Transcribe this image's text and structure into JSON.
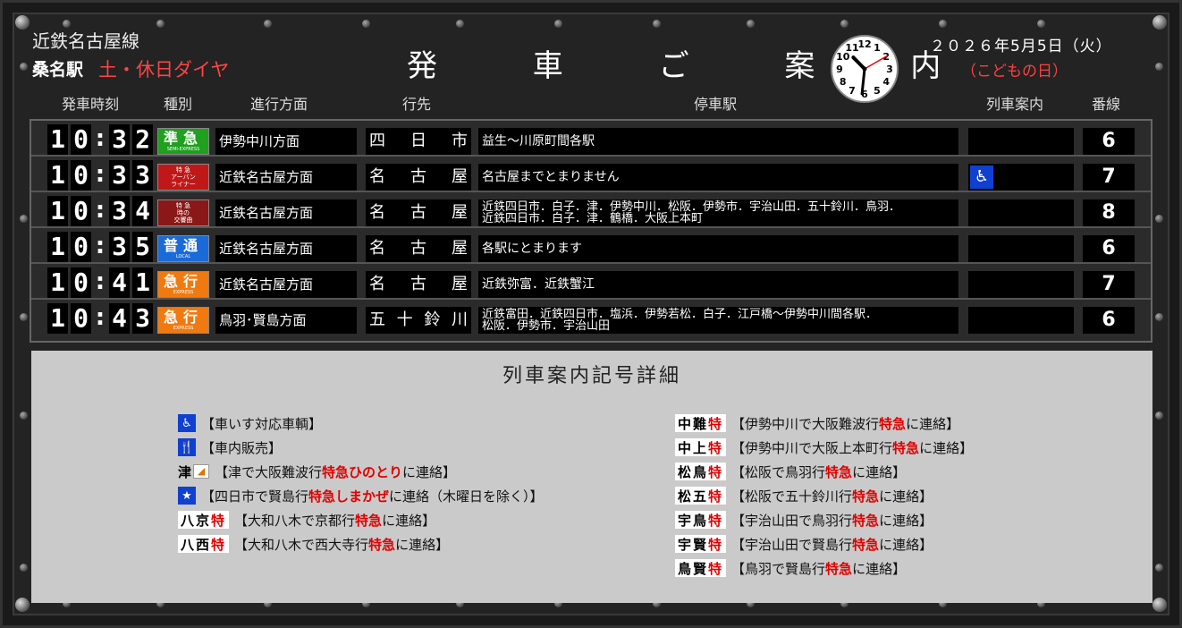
{
  "header": {
    "line_name": "近鉄名古屋線",
    "station": "桑名駅",
    "schedule": "土・休日ダイヤ",
    "title": "発 車 ご 案 内",
    "date": "２０２６年5月5日（火）",
    "holiday": "（こどもの日）",
    "clock": {
      "hour": 10,
      "minute": 31,
      "second": 10,
      "numbers": [
        "12",
        "1",
        "2",
        "3",
        "4",
        "5",
        "6",
        "7",
        "8",
        "9",
        "10",
        "11"
      ]
    }
  },
  "columns": {
    "time": "発車時刻",
    "type": "種別",
    "direction": "進行方面",
    "destination": "行先",
    "stops": "停車駅",
    "notice": "列車案内",
    "platform": "番線"
  },
  "trains": [
    {
      "time": [
        "1",
        "0",
        "3",
        "2"
      ],
      "type_main": "準急",
      "type_sub": "SEMI-EXPRESS",
      "type_color": "#1fa01f",
      "direction": "伊勢中川方面",
      "dest": [
        "四",
        "日",
        "市"
      ],
      "stops": [
        "益生～川原町間各駅"
      ],
      "wheelchair": false,
      "platform": "6"
    },
    {
      "time": [
        "1",
        "0",
        "3",
        "3"
      ],
      "type_main": "",
      "type_img": [
        "特 急",
        "アーバン",
        "ライナー"
      ],
      "type_color": "#c01818",
      "direction": "近鉄名古屋方面",
      "dest": [
        "名",
        "古",
        "屋"
      ],
      "stops": [
        "名古屋までとまりません"
      ],
      "wheelchair": true,
      "platform": "7"
    },
    {
      "time": [
        "1",
        "0",
        "3",
        "4"
      ],
      "type_main": "",
      "type_img": [
        "特 急",
        "時の",
        "交響曲"
      ],
      "type_color": "#8a1818",
      "direction": "近鉄名古屋方面",
      "dest": [
        "名",
        "古",
        "屋"
      ],
      "stops": [
        "近鉄四日市．白子．津．伊勢中川．松阪．伊勢市．宇治山田．五十鈴川．鳥羽．",
        "近鉄四日市．白子．津．鶴橋．大阪上本町"
      ],
      "wheelchair": false,
      "platform": "8"
    },
    {
      "time": [
        "1",
        "0",
        "3",
        "5"
      ],
      "type_main": "普通",
      "type_sub": "LOCAL",
      "type_color": "#1a6ad8",
      "direction": "近鉄名古屋方面",
      "dest": [
        "名",
        "古",
        "屋"
      ],
      "stops": [
        "各駅にとまります"
      ],
      "wheelchair": false,
      "platform": "6"
    },
    {
      "time": [
        "1",
        "0",
        "4",
        "1"
      ],
      "type_main": "急行",
      "type_sub": "EXPRESS",
      "type_color": "#f07a10",
      "direction": "近鉄名古屋方面",
      "dest": [
        "名",
        "古",
        "屋"
      ],
      "stops": [
        "近鉄弥富．近鉄蟹江"
      ],
      "wheelchair": false,
      "platform": "7"
    },
    {
      "time": [
        "1",
        "0",
        "4",
        "3"
      ],
      "type_main": "急行",
      "type_sub": "EXPRESS",
      "type_color": "#f07a10",
      "direction": "鳥羽･賢島方面",
      "dest": [
        "五",
        "十",
        "鈴",
        "川"
      ],
      "stops": [
        "近鉄富田．近鉄四日市．塩浜．伊勢若松．白子．江戸橋～伊勢中川間各駅．",
        "松阪．伊勢市．宇治山田"
      ],
      "wheelchair": false,
      "platform": "6"
    }
  ],
  "legend": {
    "title": "列車案内記号詳細",
    "left": [
      {
        "sym": "♿",
        "kind": "sq",
        "text": "【車いす対応車輌】"
      },
      {
        "sym": "🍴",
        "kind": "sq",
        "text": "【車内販売】"
      },
      {
        "sym": "津",
        "kind": "hinotori",
        "pre": "【津で大阪難波行",
        "hl": "特急ひのとり",
        "post": "に連絡】"
      },
      {
        "sym": "★",
        "kind": "star",
        "pre": "【四日市で賢島行",
        "hl": "特急しまかぜ",
        "post": "に連絡（木曜日を除く）】"
      },
      {
        "sym": "八京",
        "kind": "box",
        "pre": "【大和八木で京都行",
        "hl": "特急",
        "post": "に連絡】"
      },
      {
        "sym": "八西",
        "kind": "box",
        "pre": "【大和八木で西大寺行",
        "hl": "特急",
        "post": "に連絡】"
      }
    ],
    "right": [
      {
        "sym": "中難",
        "kind": "box",
        "pre": "【伊勢中川で大阪難波行",
        "hl": "特急",
        "post": "に連絡】"
      },
      {
        "sym": "中上",
        "kind": "box",
        "pre": "【伊勢中川で大阪上本町行",
        "hl": "特急",
        "post": "に連絡】"
      },
      {
        "sym": "松鳥",
        "kind": "box",
        "pre": "【松阪で鳥羽行",
        "hl": "特急",
        "post": "に連絡】"
      },
      {
        "sym": "松五",
        "kind": "box",
        "pre": "【松阪で五十鈴川行",
        "hl": "特急",
        "post": "に連絡】"
      },
      {
        "sym": "宇鳥",
        "kind": "box",
        "pre": "【宇治山田で鳥羽行",
        "hl": "特急",
        "post": "に連絡】"
      },
      {
        "sym": "宇賢",
        "kind": "box",
        "pre": "【宇治山田で賢島行",
        "hl": "特急",
        "post": "に連絡】"
      },
      {
        "sym": "鳥賢",
        "kind": "box",
        "pre": "【鳥羽で賢島行",
        "hl": "特急",
        "post": "に連絡】"
      }
    ],
    "special_suffix": "特"
  }
}
